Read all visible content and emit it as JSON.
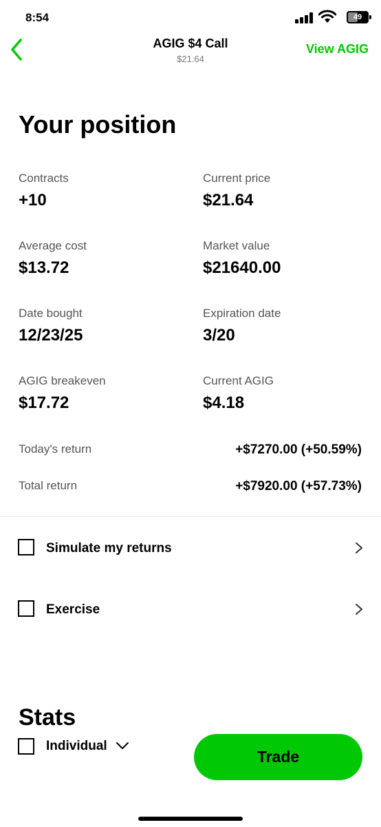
{
  "status_bar": {
    "time": "8:54",
    "battery": "49",
    "battery_level": 0.49,
    "icons": [
      "signal-icon",
      "wifi-icon",
      "battery-icon"
    ]
  },
  "header": {
    "title": "AGIG $4 Call",
    "subtitle": "$21.64",
    "view_link": "View AGIG",
    "back_icon": "chevron-left-icon"
  },
  "position": {
    "title": "Your position",
    "fields": [
      {
        "label": "Contracts",
        "value": "+10"
      },
      {
        "label": "Current price",
        "value": "$21.64"
      },
      {
        "label": "Average cost",
        "value": "$13.72"
      },
      {
        "label": "Market value",
        "value": "$21640.00"
      },
      {
        "label": "Date bought",
        "value": "12/23/25"
      },
      {
        "label": "Expiration date",
        "value": "3/20"
      },
      {
        "label": "AGIG breakeven",
        "value": "$17.72"
      },
      {
        "label": "Current AGIG",
        "value": "$4.18"
      }
    ],
    "returns": [
      {
        "label": "Today's return",
        "value": "+$7270.00 (+50.59%)"
      },
      {
        "label": "Total return",
        "value": "+$7920.00 (+57.73%)"
      }
    ]
  },
  "actions": [
    {
      "label": "Simulate my returns",
      "checked": false
    },
    {
      "label": "Exercise",
      "checked": false
    }
  ],
  "stats": {
    "title": "Stats",
    "filter_label": "Individual",
    "filter_checked": false
  },
  "trade_button": "Trade",
  "colors": {
    "accent": "#00c805",
    "muted_text": "#555555",
    "divider": "#e6e6e6"
  }
}
